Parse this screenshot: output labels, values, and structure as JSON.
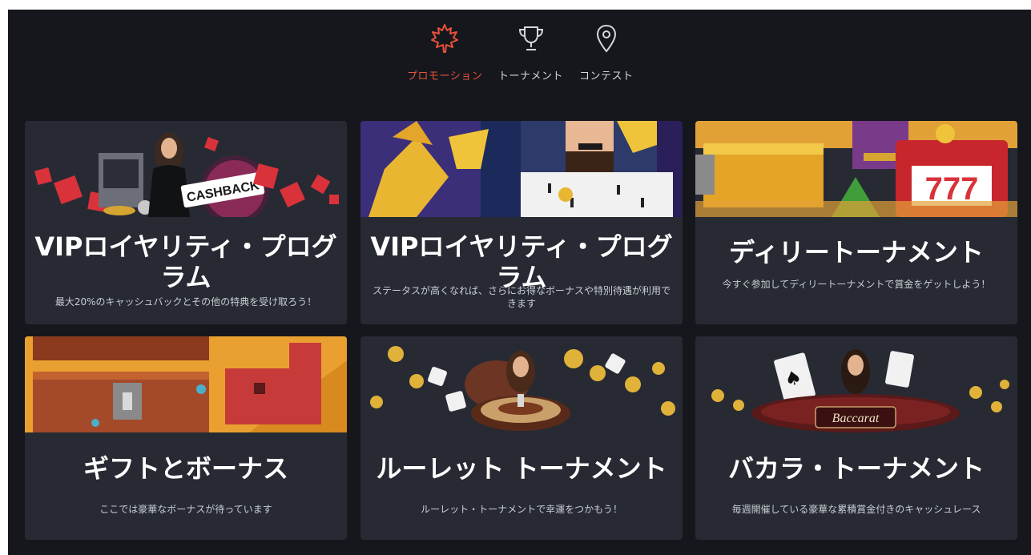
{
  "nav": {
    "tabs": [
      {
        "label": "プロモーション",
        "icon": "maple-leaf-icon",
        "active": true
      },
      {
        "label": "トーナメント",
        "icon": "trophy-icon",
        "active": false
      },
      {
        "label": "コンテスト",
        "icon": "map-pin-icon",
        "active": false
      }
    ]
  },
  "colors": {
    "background": "#15171c",
    "card": "#272a33",
    "accent": "#e8533a",
    "title": "#ffffff",
    "description": "#c9ccd3"
  },
  "cards": [
    {
      "title": "VIPロイヤリティ・プログラム",
      "description": "最大20%のキャッシュバックとその他の特典を受け取ろう！",
      "badge": "CASHBACK"
    },
    {
      "title": "VIPロイヤリティ・プログラム",
      "description": "ステータスが高くなれば、さらにお得なボーナスや特別待遇が利用できます"
    },
    {
      "title": "ディリートーナメント",
      "description": "今すぐ参加してディリートーナメントで賞金をゲットしよう！",
      "slot_digits": "777"
    },
    {
      "title": "ギフトとボーナス",
      "description": "ここでは豪華なボーナスが待っています"
    },
    {
      "title": "ルーレット トーナメント",
      "description": "ルーレット・トーナメントで幸運をつかもう！"
    },
    {
      "title": "バカラ・トーナメント",
      "description": "毎週開催している豪華な累積賞金付きのキャッシュレース",
      "badge": "Baccarat"
    }
  ]
}
